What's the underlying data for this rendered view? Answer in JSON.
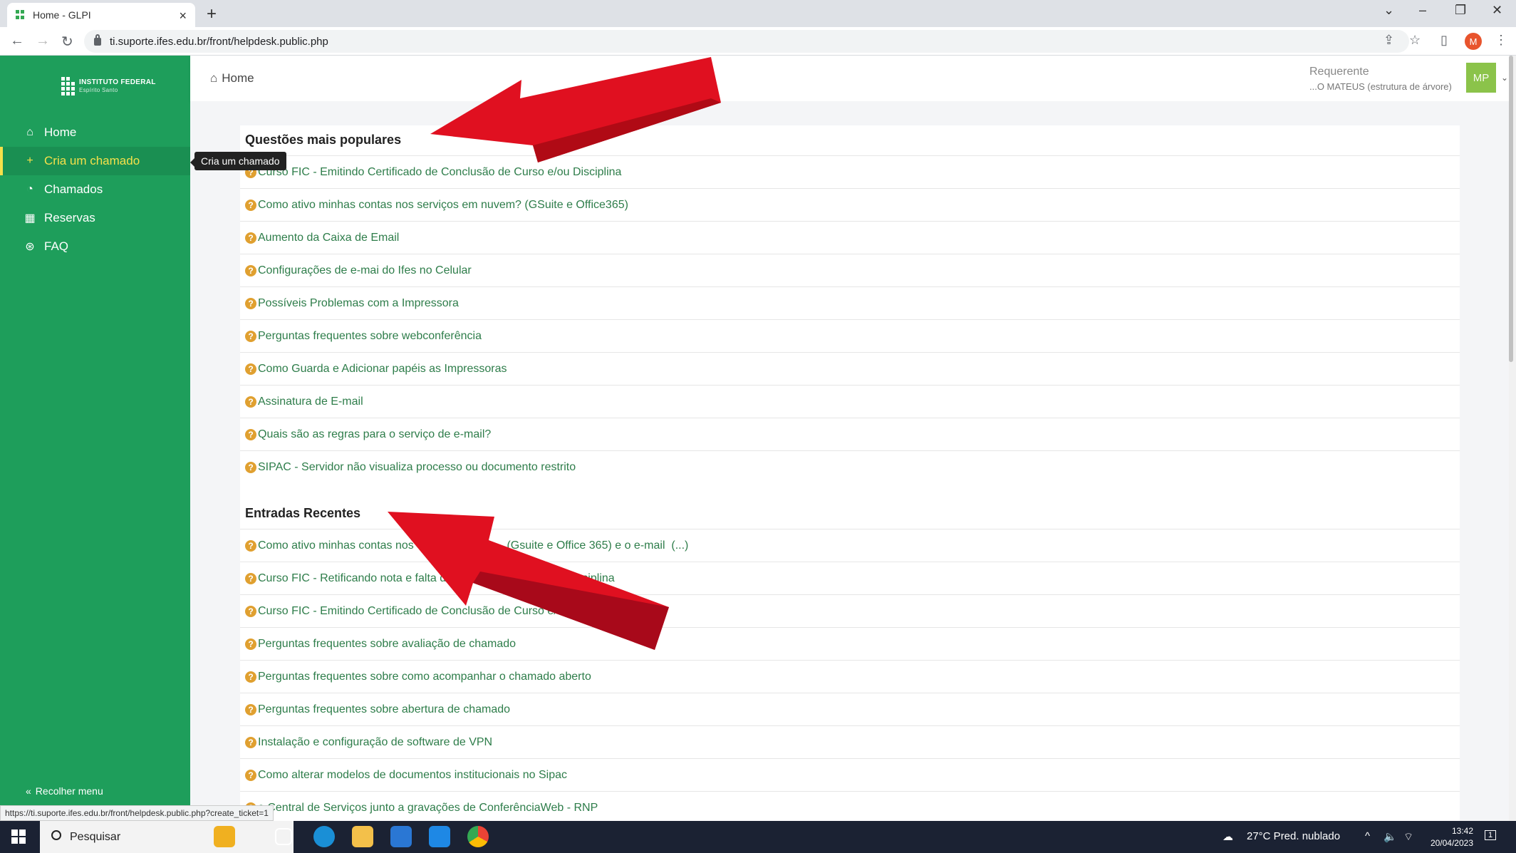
{
  "browser": {
    "tab_title": "Home - GLPI",
    "url": "ti.suporte.ifes.edu.br/front/helpdesk.public.php",
    "profile_initial": "M",
    "status_url": "https://ti.suporte.ifes.edu.br/front/helpdesk.public.php?create_ticket=1"
  },
  "sidebar": {
    "logo_line1": "INSTITUTO FEDERAL",
    "logo_line2": "Espírito Santo",
    "items": [
      {
        "label": "Home",
        "icon": "home-icon"
      },
      {
        "label": "Cria um chamado",
        "icon": "plus-icon"
      },
      {
        "label": "Chamados",
        "icon": "alert-circle-icon"
      },
      {
        "label": "Reservas",
        "icon": "calendar-icon"
      },
      {
        "label": "FAQ",
        "icon": "lifebuoy-icon"
      }
    ],
    "collapse_label": "Recolher menu",
    "tooltip": "Cria um chamado"
  },
  "header": {
    "breadcrumb": "Home",
    "role": "Requerente",
    "entity": "...O MATEUS (estrutura de árvore)",
    "avatar_initials": "MP"
  },
  "popular": {
    "title": "Questões mais populares",
    "items": [
      "Curso FIC - Emitindo Certificado de Conclusão de Curso e/ou Disciplina",
      "Como ativo minhas contas nos serviços em nuvem? (GSuite e Office365)",
      "Aumento da Caixa de Email",
      "Configurações de e-mai do Ifes no Celular",
      "Possíveis Problemas com a Impressora",
      "Perguntas frequentes sobre webconferência",
      "Como Guarda e Adicionar papéis as Impressoras",
      "Assinatura de E-mail",
      "Quais são as regras para o serviço de e-mail?",
      "SIPAC - Servidor não visualiza processo ou documento restrito"
    ]
  },
  "recent": {
    "title": "Entradas Recentes",
    "items": [
      "Como ativo minhas contas nos S                          (Gsuite e Office 365) e o e-mail  (...)",
      "Curso FIC - Retificando nota e falta de estuda                        Disciplina",
      "Curso FIC - Emitindo Certificado de Conclusão de Curso e/o",
      "Perguntas frequentes sobre avaliação de chamado",
      "Perguntas frequentes sobre como acompanhar o chamado aberto",
      "Perguntas frequentes sobre abertura de chamado",
      "Instalação e configuração de software de VPN",
      "Como alterar modelos de documentos institucionais no Sipac",
      "a Central de Serviços junto a gravações de ConferênciaWeb - RNP"
    ]
  },
  "taskbar": {
    "search_placeholder": "Pesquisar",
    "weather": "27°C  Pred. nublado",
    "time": "13:42",
    "date": "20/04/2023",
    "notification_count": "1"
  }
}
